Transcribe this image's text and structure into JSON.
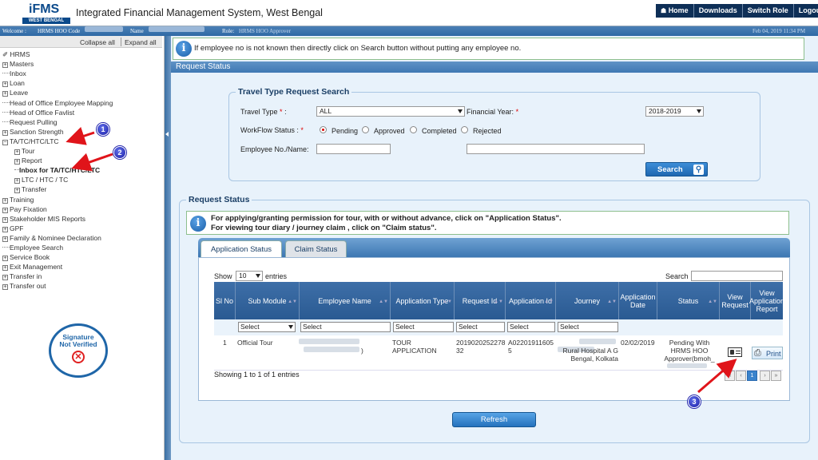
{
  "header": {
    "logo_main": "iFMS",
    "logo_sub": "WEST BENGAL",
    "title": "Integrated Financial Management System, West Bengal",
    "links": [
      "Home",
      "Downloads",
      "Switch Role",
      "Logout"
    ]
  },
  "info_strip": {
    "welcome_label": "Welcome :",
    "welcome_value": "HRMS HOO Code",
    "name_label": "Name",
    "role_label": "Role:",
    "role_value": "HRMS HOO Approver",
    "datetime": "Feb 04, 2019 11:34 PM"
  },
  "sidebar": {
    "collapse_all": "Collapse all",
    "expand_all": "Expand all",
    "items": [
      {
        "label": "HRMS",
        "type": "root"
      },
      {
        "label": "Masters",
        "type": "plus"
      },
      {
        "label": "Inbox",
        "type": "leaf"
      },
      {
        "label": "Loan",
        "type": "plus"
      },
      {
        "label": "Leave",
        "type": "plus"
      },
      {
        "label": "Head of Office Employee Mapping",
        "type": "leaf"
      },
      {
        "label": "Head of Office Favlist",
        "type": "leaf"
      },
      {
        "label": "Request Pulling",
        "type": "leaf"
      },
      {
        "label": "Sanction Strength",
        "type": "plus"
      },
      {
        "label": "TA/TC/HTC/LTC",
        "type": "minus"
      },
      {
        "label": "Tour",
        "type": "plus",
        "indent": 1
      },
      {
        "label": "Report",
        "type": "plus",
        "indent": 1
      },
      {
        "label": "Inbox for TA/TC/HTC/LTC",
        "type": "leaf-bold",
        "indent": 1
      },
      {
        "label": "LTC / HTC / TC",
        "type": "plus",
        "indent": 1
      },
      {
        "label": "Transfer",
        "type": "plus",
        "indent": 1
      },
      {
        "label": "Training",
        "type": "plus"
      },
      {
        "label": "Pay Fixation",
        "type": "plus"
      },
      {
        "label": "Stakeholder MIS Reports",
        "type": "plus"
      },
      {
        "label": "GPF",
        "type": "plus"
      },
      {
        "label": "Family & Nominee Declaration",
        "type": "plus"
      },
      {
        "label": "Employee Search",
        "type": "leaf"
      },
      {
        "label": "Service Book",
        "type": "plus"
      },
      {
        "label": "Exit Management",
        "type": "plus"
      },
      {
        "label": "Transfer in",
        "type": "plus"
      },
      {
        "label": "Transfer out",
        "type": "plus"
      }
    ],
    "signature_line1": "Signature",
    "signature_line2": "Not Verified"
  },
  "notice": "If employee no is not known then directly click on Search button without putting any employee no.",
  "section_title": "Request Status",
  "search": {
    "legend": "Travel Type Request Search",
    "travel_type_label": "Travel Type",
    "travel_type_value": "ALL",
    "financial_year_label": "Financial Year:",
    "financial_year_value": "2018-2019",
    "workflow_label": "WorkFlow Status :",
    "workflow_options": [
      "Pending",
      "Approved",
      "Completed",
      "Rejected"
    ],
    "workflow_selected": "Pending",
    "employee_label": "Employee No./Name:",
    "search_button": "Search"
  },
  "request_status": {
    "legend": "Request Status",
    "callout_line1": "For applying/granting permission for tour, with or without advance, click on \"Application Status\".",
    "callout_line2": "For viewing tour diary / journey claim , click on \"Claim status\".",
    "tabs": [
      "Application Status",
      "Claim Status"
    ],
    "active_tab": "Application Status",
    "show_label": "Show",
    "show_value": "10",
    "entries_label": "entries",
    "search_label": "Search",
    "columns": [
      "Sl No",
      "Sub Module",
      "Employee Name",
      "Application Type",
      "Request Id",
      "Application Id",
      "Journey",
      "Application Date",
      "Status",
      "View Request",
      "View Application Report"
    ],
    "filter_placeholder": "Select",
    "rows": [
      {
        "sl": "1",
        "sub_module": "Official Tour",
        "employee_name_end": ")",
        "application_type": "TOUR APPLICATION",
        "request_id": "201902025227832",
        "application_id": "A022019116055",
        "journey_visible": "Rural Hospital A G Bengal, Kolkata",
        "application_date": "02/02/2019",
        "status": "Pending With HRMS HOO Approver(bmoh_",
        "print_label": "Print"
      }
    ],
    "showing_text": "Showing 1 to 1 of 1 entries",
    "pager": [
      "«",
      "‹",
      "1",
      "›",
      "»"
    ],
    "current_page": "1"
  },
  "refresh_button": "Refresh",
  "annotations": [
    "1",
    "2",
    "3"
  ],
  "colors": {
    "header_nav": "#0e2f57",
    "accent_blue": "#2a5a92",
    "annotation_red": "#e0141a",
    "annotation_badge": "#1d1fa8"
  }
}
